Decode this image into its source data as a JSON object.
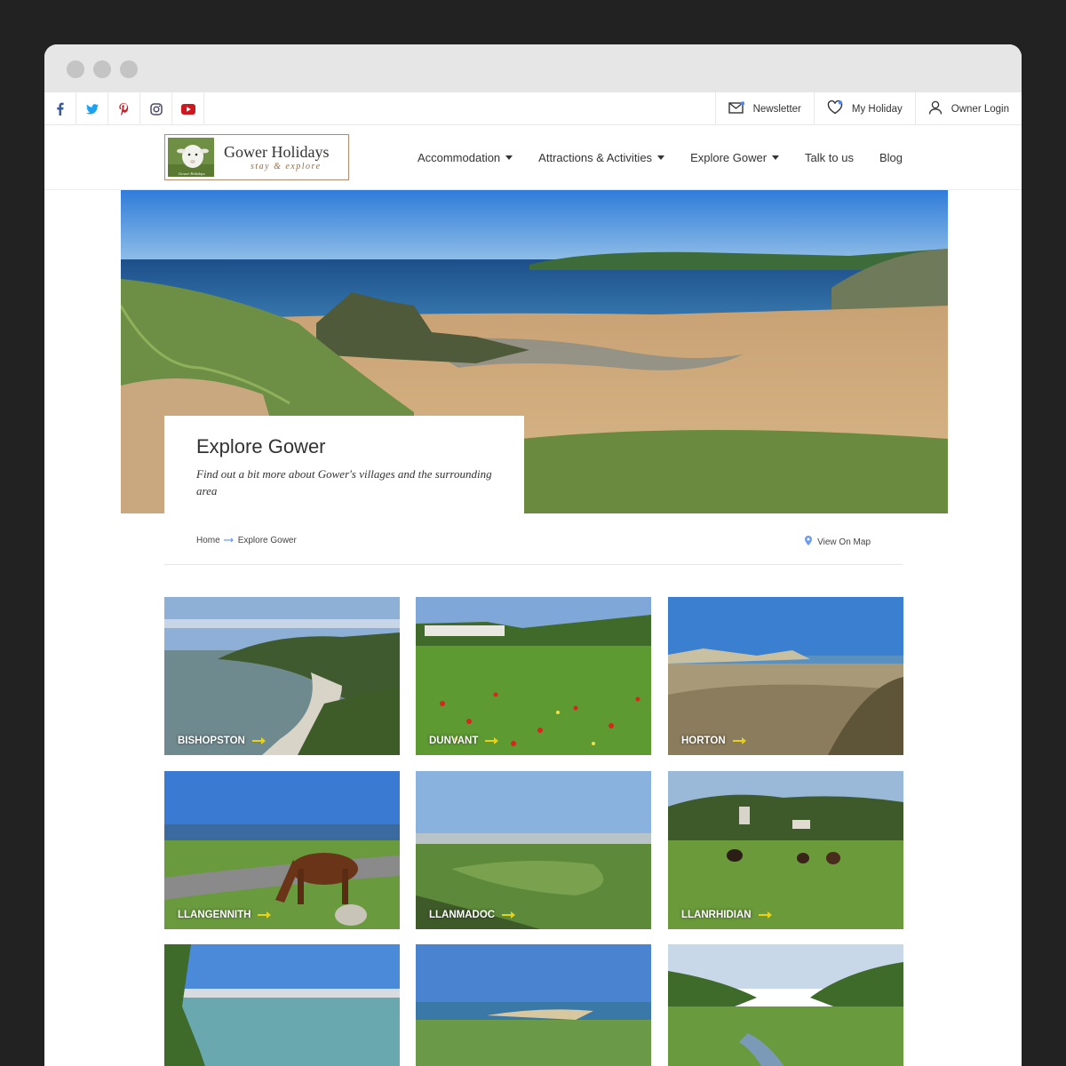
{
  "social": [
    "facebook-icon",
    "twitter-icon",
    "pinterest-icon",
    "instagram-icon",
    "youtube-icon"
  ],
  "topbar": {
    "newsletter": "Newsletter",
    "my_holiday": "My Holiday",
    "owner_login": "Owner Login"
  },
  "logo": {
    "title": "Gower Holidays",
    "subtitle": "stay & explore",
    "badge": "Gower Holidays"
  },
  "nav": [
    {
      "label": "Accommodation",
      "dropdown": true
    },
    {
      "label": "Attractions & Activities",
      "dropdown": true
    },
    {
      "label": "Explore Gower",
      "dropdown": true
    },
    {
      "label": "Talk to us",
      "dropdown": false
    },
    {
      "label": "Blog",
      "dropdown": false
    }
  ],
  "hero": {
    "title": "Explore Gower",
    "subtitle": "Find out a bit more about Gower's villages and the surrounding area"
  },
  "breadcrumb": {
    "home": "Home",
    "current": "Explore Gower",
    "map": "View On Map"
  },
  "cards": [
    "BISHOPSTON",
    "DUNVANT",
    "HORTON",
    "LLANGENNITH",
    "LLANMADOC",
    "LLANRHIDIAN",
    "",
    "",
    ""
  ],
  "colors": {
    "accent": "#6c9cf0",
    "arrow": "#e6d21a"
  }
}
